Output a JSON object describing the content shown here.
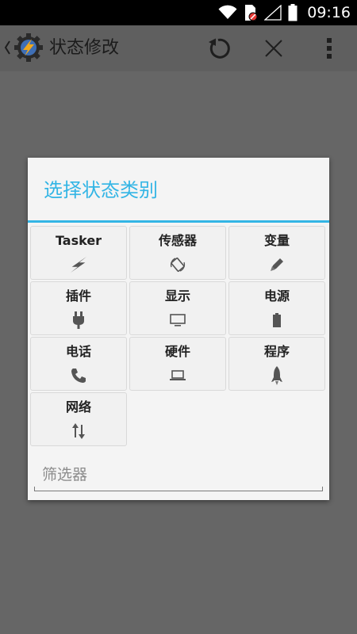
{
  "status_bar": {
    "time": "09:16",
    "icons": [
      "wifi-icon",
      "sim-card-blocked-icon",
      "no-signal-icon",
      "battery-icon"
    ]
  },
  "action_bar": {
    "title": "状态修改",
    "app_icon": "tasker-gear-icon",
    "actions": [
      {
        "name": "revert-button",
        "icon": "refresh-icon"
      },
      {
        "name": "close-button",
        "icon": "close-icon"
      },
      {
        "name": "overflow-menu-button",
        "icon": "more-vert-icon"
      }
    ]
  },
  "dialog": {
    "title": "选择状态类别",
    "categories": [
      {
        "label": "Tasker",
        "icon": "bolt-icon"
      },
      {
        "label": "传感器",
        "icon": "rotate-icon"
      },
      {
        "label": "变量",
        "icon": "pencil-icon"
      },
      {
        "label": "插件",
        "icon": "plug-icon"
      },
      {
        "label": "显示",
        "icon": "monitor-icon"
      },
      {
        "label": "电源",
        "icon": "battery-icon"
      },
      {
        "label": "电话",
        "icon": "phone-icon"
      },
      {
        "label": "硬件",
        "icon": "laptop-icon"
      },
      {
        "label": "程序",
        "icon": "rocket-icon"
      },
      {
        "label": "网络",
        "icon": "data-transfer-icon"
      }
    ],
    "filter": {
      "placeholder": "筛选器",
      "value": ""
    }
  },
  "colors": {
    "accent": "#33b5e5",
    "dim_background": "#666666",
    "dialog_background": "#f4f4f4"
  }
}
